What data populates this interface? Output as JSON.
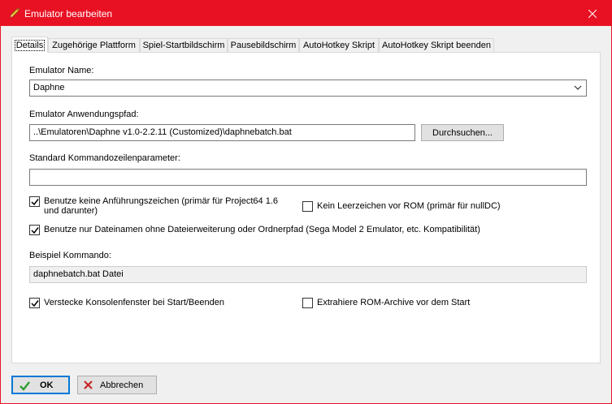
{
  "window": {
    "title": "Emulator bearbeiten",
    "accent": "#e81123"
  },
  "tabs": [
    {
      "label": "Details",
      "active": true
    },
    {
      "label": "Zugehörige Plattform"
    },
    {
      "label": "Spiel-Startbildschirm"
    },
    {
      "label": "Pausebildschirm"
    },
    {
      "label": "AutoHotkey Skript"
    },
    {
      "label": "AutoHotkey Skript beenden"
    }
  ],
  "form": {
    "emulator_name_label": "Emulator Name:",
    "emulator_name_value": "Daphne",
    "app_path_label": "Emulator Anwendungspfad:",
    "app_path_value": "..\\Emulatoren\\Daphne v1.0-2.2.11 (Customized)\\daphnebatch.bat",
    "browse_button": "Durchsuchen...",
    "cmdline_label": "Standard Kommandozeilenparameter:",
    "cmdline_value": "",
    "checkboxes": {
      "no_quotes": {
        "label": "Benutze keine Anführungszeichen (primär für Project64 1.6 und darunter)",
        "checked": true
      },
      "no_space": {
        "label": "Kein Leerzeichen vor ROM (primär für nullDC)",
        "checked": false
      },
      "filename_only": {
        "label": "Benutze nur Dateinamen ohne Dateierweiterung oder Ordnerpfad (Sega Model 2 Emulator, etc. Kompatibilität)",
        "checked": true
      },
      "hide_console": {
        "label": "Verstecke Konsolenfenster bei Start/Beenden",
        "checked": true
      },
      "extract_rom": {
        "label": "Extrahiere ROM-Archive vor dem Start",
        "checked": false
      }
    },
    "example_label": "Beispiel Kommando:",
    "example_value": "daphnebatch.bat Datei"
  },
  "footer": {
    "ok": "OK",
    "cancel": "Abbrechen"
  },
  "icons": {
    "title": "pencil-icon",
    "ok": "checkmark-icon",
    "cancel": "x-icon"
  }
}
